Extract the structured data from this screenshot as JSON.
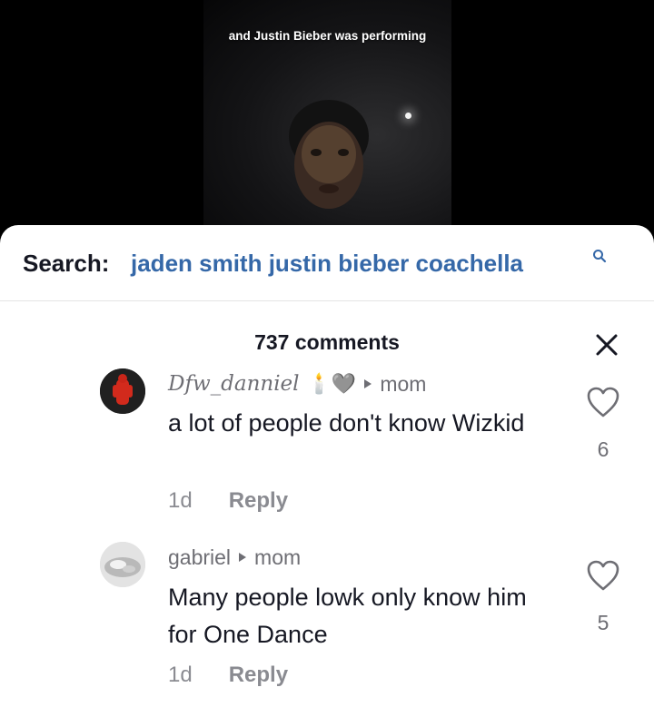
{
  "video": {
    "caption": "and Justin Bieber was performing"
  },
  "search": {
    "label": "Search:",
    "query": "jaden smith justin bieber coachella"
  },
  "comments_header": {
    "count_text": "737 comments"
  },
  "comments": [
    {
      "username": "Dfw_danniel",
      "badges": "🕯️🩶",
      "reply_target": "mom",
      "text": "a lot of people don't know Wizkid",
      "age": "1d",
      "reply_label": "Reply",
      "likes": "6"
    },
    {
      "username": "gabriel",
      "badges": "",
      "reply_target": "mom",
      "text": "Many people lowk only know him for One Dance",
      "age": "1d",
      "reply_label": "Reply",
      "likes": "5"
    }
  ],
  "colors": {
    "search_query": "#3568a8",
    "text_primary": "#161823",
    "text_secondary": "#8a8b91"
  }
}
